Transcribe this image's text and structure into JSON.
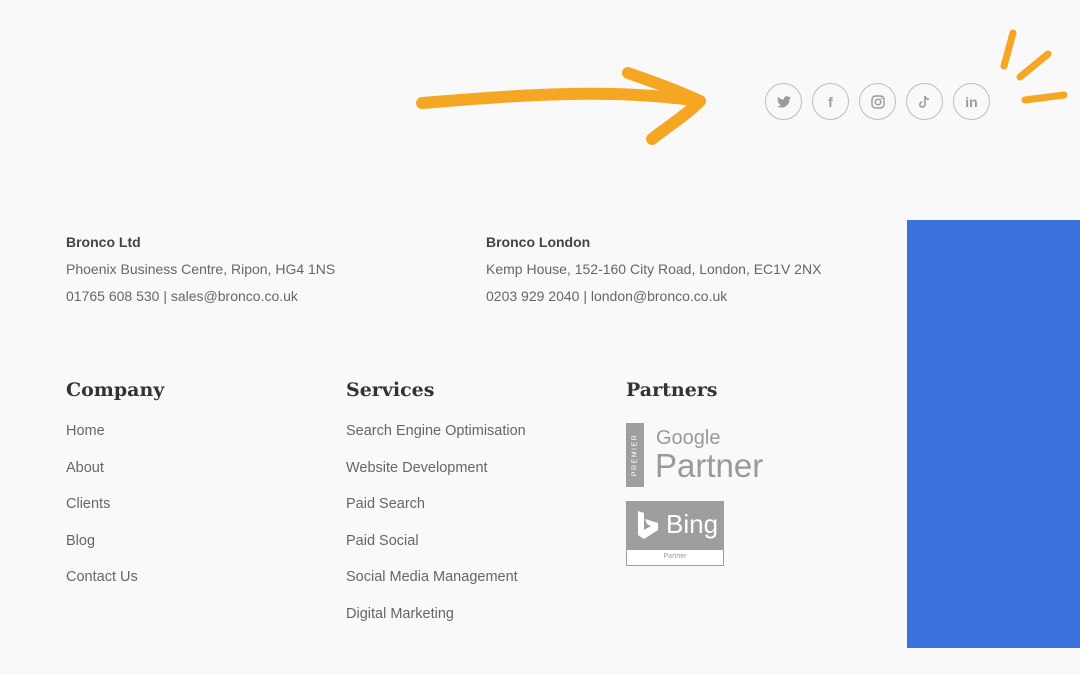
{
  "social": {
    "items": [
      {
        "name": "twitter-icon",
        "label": "Twitter"
      },
      {
        "name": "facebook-icon",
        "label": "Facebook",
        "glyph": "f"
      },
      {
        "name": "instagram-icon",
        "label": "Instagram"
      },
      {
        "name": "tiktok-icon",
        "label": "TikTok"
      },
      {
        "name": "linkedin-icon",
        "label": "LinkedIn",
        "glyph": "in"
      }
    ]
  },
  "offices": [
    {
      "name": "Bronco Ltd",
      "address": "Phoenix Business Centre, Ripon, HG4 1NS",
      "phone": "01765 608 530",
      "email": "sales@bronco.co.uk"
    },
    {
      "name": "Bronco London",
      "address": "Kemp House, 152-160 City Road, London, EC1V 2NX",
      "phone": "0203 929 2040",
      "email": "london@bronco.co.uk"
    }
  ],
  "separator": "|",
  "company": {
    "heading": "Company",
    "links": [
      "Home",
      "About",
      "Clients",
      "Blog",
      "Contact Us"
    ]
  },
  "services": {
    "heading": "Services",
    "links": [
      "Search Engine Optimisation",
      "Website Development",
      "Paid Search",
      "Paid Social",
      "Social Media Management",
      "Digital Marketing"
    ]
  },
  "partners": {
    "heading": "Partners",
    "google": {
      "badge": "PREMIER",
      "line1": "Google",
      "line2": "Partner"
    },
    "bing": {
      "word": "Bing",
      "sub": "Partner"
    }
  },
  "colors": {
    "accent_orange": "#f5a623",
    "blue_panel": "#3a72dd",
    "icon_grey": "#9a9a9a"
  }
}
